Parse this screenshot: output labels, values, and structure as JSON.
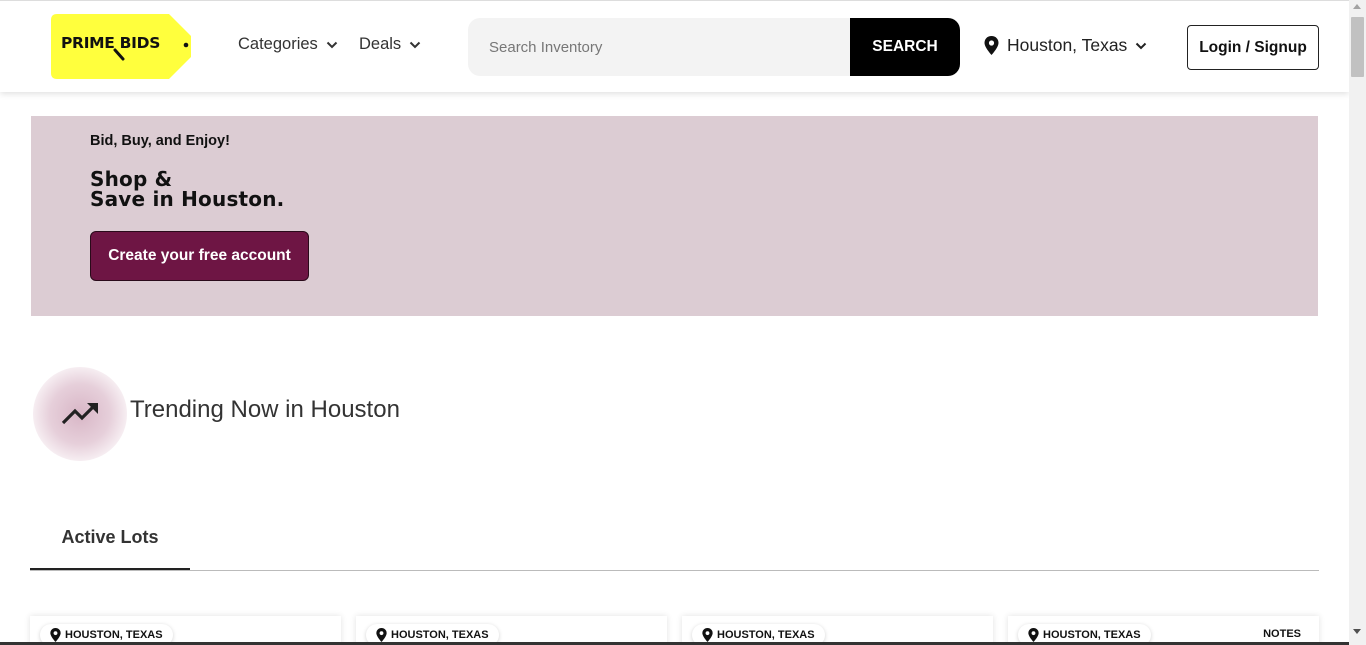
{
  "header": {
    "logo_text": "PRIME BIDS",
    "nav": [
      {
        "label": "Categories"
      },
      {
        "label": "Deals"
      }
    ],
    "search": {
      "placeholder": "Search Inventory",
      "value": "",
      "button_label": "SEARCH"
    },
    "location": "Houston, Texas",
    "login_label": "Login / Signup"
  },
  "banner": {
    "tagline": "Bid, Buy, and Enjoy!",
    "title_line1": "Shop &",
    "title_line2": "Save in Houston.",
    "cta_label": "Create your free account"
  },
  "trending": {
    "title": "Trending Now in Houston"
  },
  "tabs": [
    {
      "label": "Active Lots",
      "active": true
    }
  ],
  "lots": [
    {
      "location": "HOUSTON, TEXAS",
      "notes": ""
    },
    {
      "location": "HOUSTON, TEXAS",
      "notes": ""
    },
    {
      "location": "HOUSTON, TEXAS",
      "notes": ""
    },
    {
      "location": "HOUSTON, TEXAS",
      "notes": "NOTES"
    }
  ],
  "colors": {
    "logo_yellow": "#ffff3d",
    "banner_bg": "#dcccd3",
    "cta_bg": "#6e1544",
    "search_button_bg": "#000000"
  }
}
